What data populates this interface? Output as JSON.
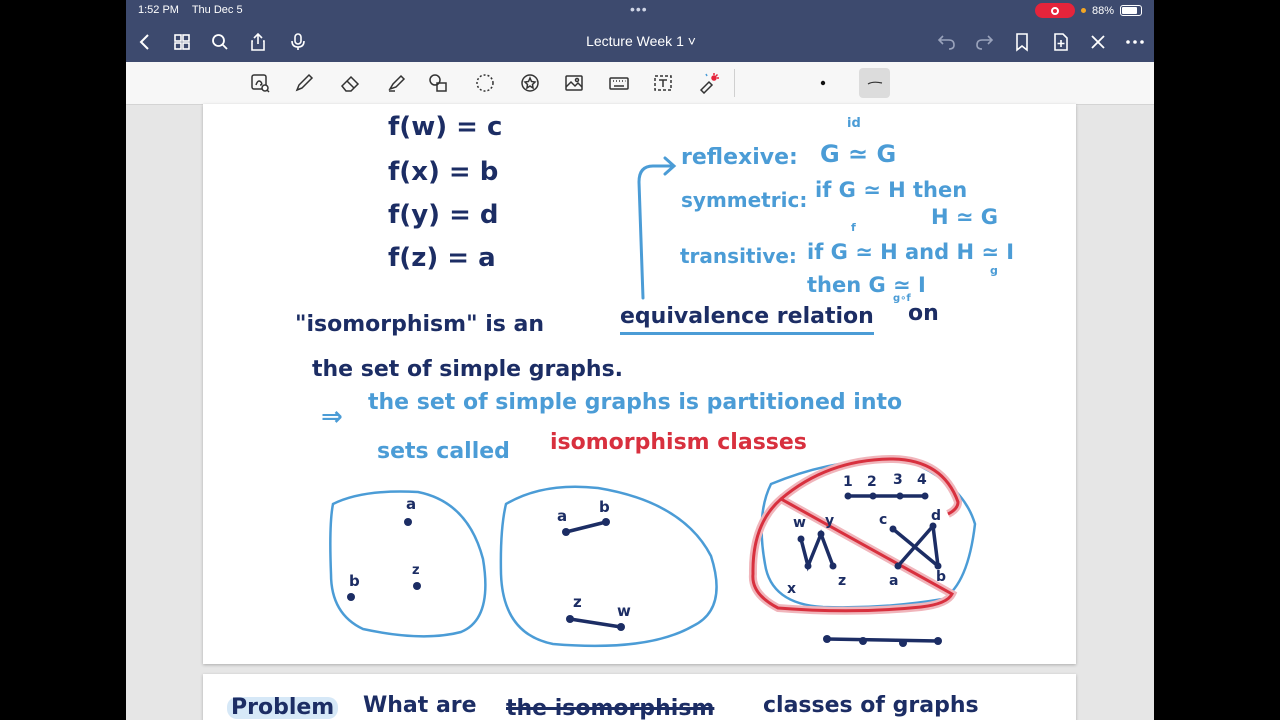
{
  "status_bar": {
    "time": "1:52 PM",
    "date": "Thu Dec 5",
    "battery": "88%",
    "battery_level": 0.88
  },
  "nav": {
    "title": "Lecture Week 1"
  },
  "toolbar": {
    "tools": [
      "lasso-select-icon",
      "pen-icon",
      "eraser-icon",
      "highlighter-icon",
      "shapes-icon",
      "lasso-icon",
      "sticker-icon",
      "image-icon",
      "keyboard-icon",
      "text-box-icon",
      "laser-pointer-icon"
    ],
    "active_tool": "pen-thin-line"
  },
  "colors": {
    "navy_ink": "#1c2d64",
    "blue_ink": "#4b9cd6",
    "red_ink": "#d8303e",
    "nav_bar": "#3d4a6e",
    "status_record": "#e5243b"
  },
  "notes": {
    "f_w": "f(w) = c",
    "f_x": "f(x) = b",
    "f_y": "f(y) = d",
    "f_z": "f(z) = a",
    "reflexive": "reflexive:",
    "reflexive_expr": "G ≃ G",
    "reflexive_sup": "id",
    "symmetric": "symmetric:",
    "symmetric_expr": "if G ≃ H  then",
    "symmetric_expr2": "H ≃ G",
    "transitive": "transitive:",
    "transitive_expr": "if G ≃ H  and  H ≃ I",
    "transitive_sup_f": "f",
    "transitive_sub_g": "g",
    "transitive_expr2": "then  G ≃ I",
    "transitive_sub_gf": "g∘f",
    "line1_a": "\"isomorphism\"  is  an",
    "line1_b": "equivalence relation",
    "line1_c": "on",
    "line2": "the  set  of  simple  graphs.",
    "arrow": "⇒",
    "line3": "the  set  of  simple  graphs  is  partitioned  into",
    "line4_a": "sets  called",
    "line4_b": "isomorphism  classes",
    "problem_label": "Problem",
    "problem_a": "What  are",
    "problem_struck": "the  isomorphism",
    "problem_b": "classes  of  graphs"
  },
  "graph_labels": {
    "g1": [
      "a",
      "b",
      "z"
    ],
    "g2": [
      "a",
      "b",
      "z",
      "w"
    ],
    "g3_top": [
      "1",
      "2",
      "3",
      "4"
    ],
    "g3_left": [
      "w",
      "y",
      "x",
      "z"
    ],
    "g3_right": [
      "c",
      "d",
      "a",
      "b"
    ]
  }
}
